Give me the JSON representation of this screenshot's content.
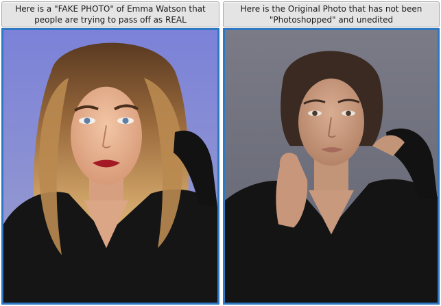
{
  "panels": [
    {
      "caption_line1": "Here is a \"FAKE PHOTO\" of Emma Watson that",
      "caption_line2": "people are trying to pass off as REAL",
      "photo_alt": "Retouched portrait of Emma Watson with long wavy blonde hair and red lipstick"
    },
    {
      "caption_line1": "Here is the Original Photo that has not been",
      "caption_line2": "\"Photoshopped\" and unedited",
      "photo_alt": "Original unedited portrait of Emma Watson with dark hair pulled back"
    }
  ],
  "colors": {
    "frame_border": "#2f78c4",
    "caption_bg": "#e4e4e4",
    "left_backdrop": "#8a8fd0",
    "right_backdrop": "#6e6f7c"
  }
}
